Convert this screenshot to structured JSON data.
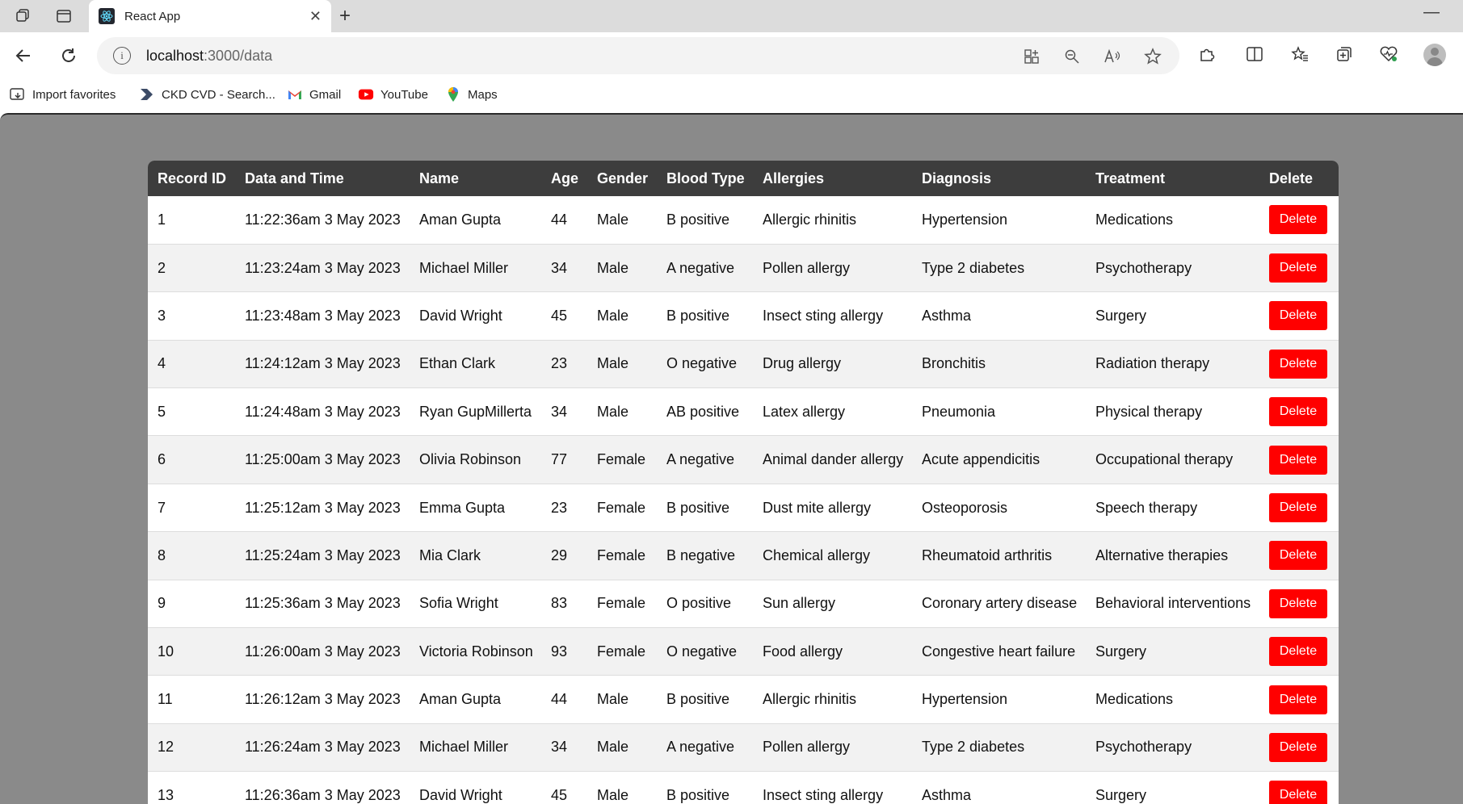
{
  "browser": {
    "tab_title": "React App",
    "tab_close": "✕",
    "new_tab": "+",
    "minimize": "—",
    "address_host": "localhost",
    "address_path": ":3000/data",
    "info_icon": "i",
    "favorites": [
      {
        "label": "Import favorites",
        "icon": "import-favorites-icon"
      },
      {
        "label": "CKD CVD - Search...",
        "icon": "bookmark-icon"
      },
      {
        "label": "Gmail",
        "icon": "gmail-icon"
      },
      {
        "label": "YouTube",
        "icon": "youtube-icon"
      },
      {
        "label": "Maps",
        "icon": "maps-icon"
      }
    ]
  },
  "table": {
    "headers": {
      "record_id": "Record ID",
      "date_time": "Data and Time",
      "name": "Name",
      "age": "Age",
      "gender": "Gender",
      "blood_type": "Blood Type",
      "allergies": "Allergies",
      "diagnosis": "Diagnosis",
      "treatment": "Treatment",
      "delete": "Delete"
    },
    "delete_label": "Delete",
    "rows": [
      {
        "id": "1",
        "datetime": "11:22:36am 3 May 2023",
        "name": "Aman Gupta",
        "age": "44",
        "gender": "Male",
        "blood": "B positive",
        "allergy": "Allergic rhinitis",
        "diagnosis": "Hypertension",
        "treatment": "Medications"
      },
      {
        "id": "2",
        "datetime": "11:23:24am 3 May 2023",
        "name": "Michael Miller",
        "age": "34",
        "gender": "Male",
        "blood": "A negative",
        "allergy": "Pollen allergy",
        "diagnosis": "Type 2 diabetes",
        "treatment": "Psychotherapy"
      },
      {
        "id": "3",
        "datetime": "11:23:48am 3 May 2023",
        "name": "David Wright",
        "age": "45",
        "gender": "Male",
        "blood": "B positive",
        "allergy": "Insect sting allergy",
        "diagnosis": "Asthma",
        "treatment": "Surgery"
      },
      {
        "id": "4",
        "datetime": "11:24:12am 3 May 2023",
        "name": "Ethan Clark",
        "age": "23",
        "gender": "Male",
        "blood": "O negative",
        "allergy": "Drug allergy",
        "diagnosis": "Bronchitis",
        "treatment": "Radiation therapy"
      },
      {
        "id": "5",
        "datetime": "11:24:48am 3 May 2023",
        "name": "Ryan GupMillerta",
        "age": "34",
        "gender": "Male",
        "blood": "AB positive",
        "allergy": "Latex allergy",
        "diagnosis": "Pneumonia",
        "treatment": "Physical therapy"
      },
      {
        "id": "6",
        "datetime": "11:25:00am 3 May 2023",
        "name": "Olivia Robinson",
        "age": "77",
        "gender": "Female",
        "blood": "A negative",
        "allergy": "Animal dander allergy",
        "diagnosis": "Acute appendicitis",
        "treatment": "Occupational therapy"
      },
      {
        "id": "7",
        "datetime": "11:25:12am 3 May 2023",
        "name": "Emma Gupta",
        "age": "23",
        "gender": "Female",
        "blood": "B positive",
        "allergy": "Dust mite allergy",
        "diagnosis": "Osteoporosis",
        "treatment": "Speech therapy"
      },
      {
        "id": "8",
        "datetime": "11:25:24am 3 May 2023",
        "name": "Mia Clark",
        "age": "29",
        "gender": "Female",
        "blood": "B negative",
        "allergy": "Chemical allergy",
        "diagnosis": "Rheumatoid arthritis",
        "treatment": "Alternative therapies"
      },
      {
        "id": "9",
        "datetime": "11:25:36am 3 May 2023",
        "name": "Sofia Wright",
        "age": "83",
        "gender": "Female",
        "blood": "O positive",
        "allergy": "Sun allergy",
        "diagnosis": "Coronary artery disease",
        "treatment": "Behavioral interventions"
      },
      {
        "id": "10",
        "datetime": "11:26:00am 3 May 2023",
        "name": "Victoria Robinson",
        "age": "93",
        "gender": "Female",
        "blood": "O negative",
        "allergy": "Food allergy",
        "diagnosis": "Congestive heart failure",
        "treatment": "Surgery"
      },
      {
        "id": "11",
        "datetime": "11:26:12am 3 May 2023",
        "name": "Aman Gupta",
        "age": "44",
        "gender": "Male",
        "blood": "B positive",
        "allergy": "Allergic rhinitis",
        "diagnosis": "Hypertension",
        "treatment": "Medications"
      },
      {
        "id": "12",
        "datetime": "11:26:24am 3 May 2023",
        "name": "Michael Miller",
        "age": "34",
        "gender": "Male",
        "blood": "A negative",
        "allergy": "Pollen allergy",
        "diagnosis": "Type 2 diabetes",
        "treatment": "Psychotherapy"
      },
      {
        "id": "13",
        "datetime": "11:26:36am 3 May 2023",
        "name": "David Wright",
        "age": "45",
        "gender": "Male",
        "blood": "B positive",
        "allergy": "Insect sting allergy",
        "diagnosis": "Asthma",
        "treatment": "Surgery"
      }
    ]
  }
}
